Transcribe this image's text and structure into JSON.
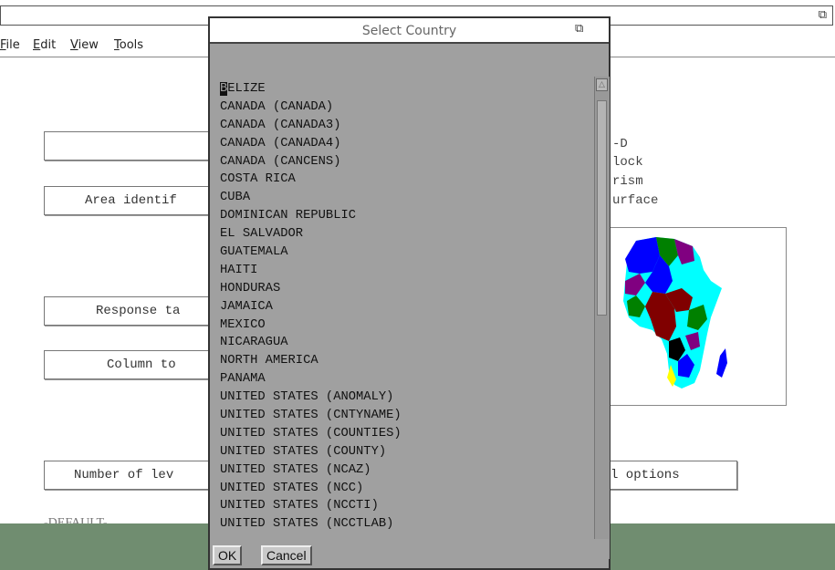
{
  "window": {
    "restore_icon": "restore-window-icon",
    "menu": [
      "File",
      "Edit",
      "View",
      "Tools"
    ]
  },
  "form": {
    "area_label": "Area identif",
    "response_label": "Response ta",
    "column_label": "Column to",
    "levels_label": "Number of lev",
    "options_label": "l options",
    "default_label": "-DEFAULT-",
    "side_options": [
      "-D",
      "lock",
      "rism",
      "urface"
    ]
  },
  "dialog": {
    "title": "Select Country",
    "items": [
      "BELIZE",
      "CANADA (CANADA)",
      "CANADA (CANADA3)",
      "CANADA (CANADA4)",
      "CANADA (CANCENS)",
      "COSTA RICA",
      "CUBA",
      "DOMINICAN REPUBLIC",
      "EL SALVADOR",
      "GUATEMALA",
      "HAITI",
      "HONDURAS",
      "JAMAICA",
      "MEXICO",
      "NICARAGUA",
      "NORTH AMERICA",
      "PANAMA",
      "UNITED STATES (ANOMALY)",
      "UNITED STATES (CNTYNAME)",
      "UNITED STATES (COUNTIES)",
      "UNITED STATES (COUNTY)",
      "UNITED STATES (NCAZ)",
      "UNITED STATES (NCC)",
      "UNITED STATES (NCCTI)",
      "UNITED STATES (NCCTLAB)"
    ],
    "ok_label": "OK",
    "cancel_label": "Cancel"
  },
  "colors": {
    "map_blue": "#0000ff",
    "map_cyan": "#00ffff",
    "map_green": "#008000",
    "map_maroon": "#800000",
    "map_purple": "#800080",
    "map_yellow": "#ffff00",
    "bottom_band": "#708d70"
  }
}
